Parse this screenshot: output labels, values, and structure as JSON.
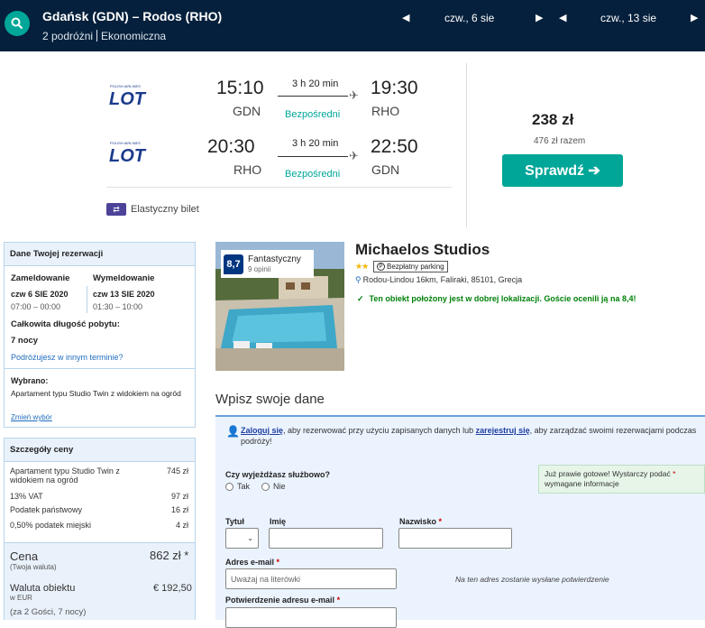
{
  "header": {
    "route": "Gdańsk (GDN) – Rodos (RHO)",
    "travellers": "2 podróżni",
    "cabin": "Ekonomiczna",
    "depart_date": "czw., 6 sie",
    "return_date": "czw., 13 sie"
  },
  "flight": {
    "airline_logo_text": "LOT",
    "airline_logo_small": "POLISH AIRLINES",
    "outbound": {
      "depart_time": "15:10",
      "depart_code": "GDN",
      "duration": "3 h 20 min",
      "type": "Bezpośredni",
      "arrive_time": "19:30",
      "arrive_code": "RHO"
    },
    "inbound": {
      "depart_time": "20:30",
      "depart_code": "RHO",
      "duration": "3 h 20 min",
      "type": "Bezpośredni",
      "arrive_time": "22:50",
      "arrive_code": "GDN"
    },
    "flex_ticket": "Elastyczny bilet",
    "price": "238 zł",
    "price_total": "476 zł razem",
    "check_button": "Sprawdź ➔"
  },
  "booking": {
    "heading": "Dane Twojej rezerwacji",
    "checkin_label": "Zameldowanie",
    "checkin_date": "czw 6 SIE 2020",
    "checkin_time": "07:00 – 00:00",
    "checkout_label": "Wymeldowanie",
    "checkout_date": "czw 13 SIE 2020",
    "checkout_time": "01:30 – 10:00",
    "stay_label": "Całkowita długość pobytu:",
    "stay_value": "7 nocy",
    "other_dates_link": "Podróżujesz w innym terminie?",
    "chosen_label": "Wybrano:",
    "chosen_value": "Apartament typu Studio Twin z widokiem na ogród",
    "change_link": "Zmień wybór"
  },
  "price_details": {
    "heading": "Szczegóły ceny",
    "rows": [
      {
        "label": "Apartament typu Studio Twin z widokiem na ogród",
        "value": "745 zł"
      },
      {
        "label": "13% VAT",
        "value": "97 zł"
      },
      {
        "label": "Podatek państwowy",
        "value": "16 zł"
      },
      {
        "label": "0,50% podatek miejski",
        "value": "4 zł"
      }
    ],
    "total_label": "Cena",
    "total_sub": "(Twoja waluta)",
    "total_value": "862 zł *",
    "property_currency_label": "Waluta obiektu",
    "property_currency_sub": "w EUR",
    "property_currency_value": "€ 192,50",
    "guests_note": "(za 2 Gości, 7 nocy)"
  },
  "hotel": {
    "score": "8,7",
    "rating_label": "Fantastyczny",
    "reviews": "9 opinii",
    "name": "Michaelos Studios",
    "stars": "★★",
    "parking": "Bezpłatny parking",
    "address": "Rodou-Lindou 16km, Faliraki, 85101, Grecja",
    "location_note": "Ten obiekt położony jest w dobrej lokalizacji. Goście ocenili ją na 8,4!"
  },
  "form": {
    "title": "Wpisz swoje dane",
    "login_link": "Zaloguj się",
    "login_text_1": ", aby rezerwować przy użyciu zapisanych danych lub ",
    "register_link": "zarejestruj się",
    "login_text_2": ", aby zarządzać swoimi rezerwacjami podczas podróży!",
    "business_question": "Czy wyjeżdżasz służbowo?",
    "yes_label": "Tak",
    "no_label": "Nie",
    "almost_text": "Już prawie gotowe! Wystarczy podać",
    "almost_star": "*",
    "almost_text_2": "wymagane informacje",
    "title_label": "Tytuł",
    "first_name_label": "Imię",
    "last_name_label": "Nazwisko",
    "email_label": "Adres e-mail",
    "email_placeholder": "Uważaj na literówki",
    "email_note": "Na ten adres zostanie wysłane potwierdzenie",
    "email_confirm_label": "Potwierdzenie adresu e-mail",
    "required_mark": "*"
  },
  "colors": {
    "topbar": "#05203c",
    "accent": "#00a698",
    "score_bg": "#003580",
    "link": "#1f6dbd"
  }
}
